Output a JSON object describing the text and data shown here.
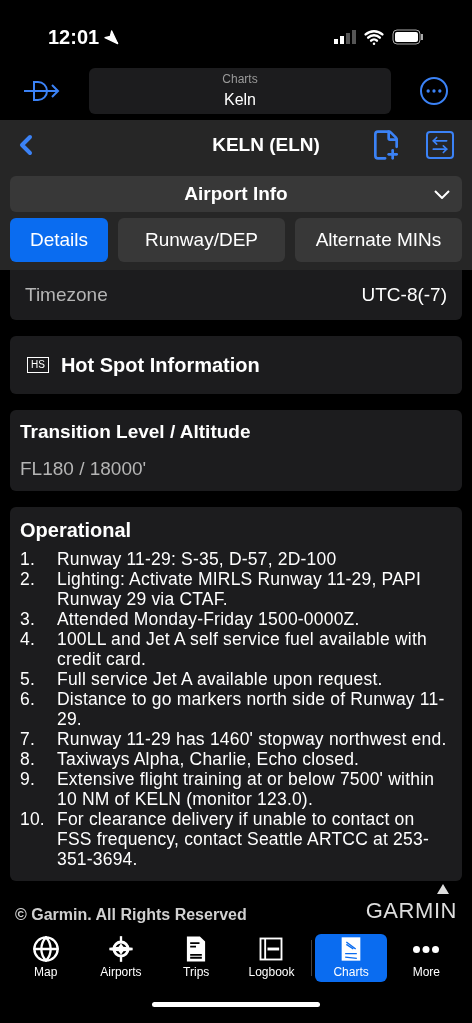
{
  "status_bar": {
    "time": "12:01"
  },
  "nav": {
    "subtitle": "Charts",
    "title": "Keln"
  },
  "header": {
    "title": "KELN (ELN)",
    "section": "Airport Info"
  },
  "tabs": [
    {
      "label": "Details",
      "selected": true
    },
    {
      "label": "Runway/DEP",
      "selected": false
    },
    {
      "label": "Alternate MINs",
      "selected": false
    }
  ],
  "timezone": {
    "label": "Timezone",
    "value": "UTC-8(-7)"
  },
  "hot_spot": {
    "badge": "HS",
    "title": "Hot Spot Information"
  },
  "transition": {
    "title": "Transition Level / Altitude",
    "value": "FL180 / 18000'"
  },
  "operational": {
    "title": "Operational",
    "items": [
      {
        "number": "1.",
        "text": "Runway 11-29: S-35, D-57, 2D-100"
      },
      {
        "number": "2.",
        "text": "Lighting: Activate MIRLS Runway 11-29, PAPI Runway 29 via CTAF."
      },
      {
        "number": "3.",
        "text": "Attended Monday-Friday 1500-0000Z."
      },
      {
        "number": "4.",
        "text": "100LL and Jet A self service fuel available with credit card."
      },
      {
        "number": "5.",
        "text": "Full service Jet A available upon request."
      },
      {
        "number": "6.",
        "text": "Distance to go markers north side of Runway 11-29."
      },
      {
        "number": "7.",
        "text": "Runway 11-29 has 1460' stopway northwest end."
      },
      {
        "number": "8.",
        "text": "Taxiways Alpha, Charlie, Echo closed."
      },
      {
        "number": "9.",
        "text": "Extensive flight training at or below 7500' within 10 NM of KELN (monitor 123.0)."
      },
      {
        "number": "10.",
        "text": "For clearance delivery if unable to contact on FSS frequency, contact Seattle ARTCC at 253-351-3694."
      }
    ]
  },
  "footer": {
    "copyright": "© Garmin. All Rights Reserved",
    "logo": "GARMIN"
  },
  "tab_bar": [
    {
      "kind": "map",
      "label": "Map",
      "selected": false
    },
    {
      "kind": "airports",
      "label": "Airports",
      "selected": false
    },
    {
      "kind": "trips",
      "label": "Trips",
      "selected": false
    },
    {
      "kind": "logbook",
      "label": "Logbook",
      "selected": false
    },
    {
      "kind": "charts",
      "label": "Charts",
      "selected": true
    },
    {
      "kind": "more",
      "label": "More",
      "selected": false
    }
  ]
}
